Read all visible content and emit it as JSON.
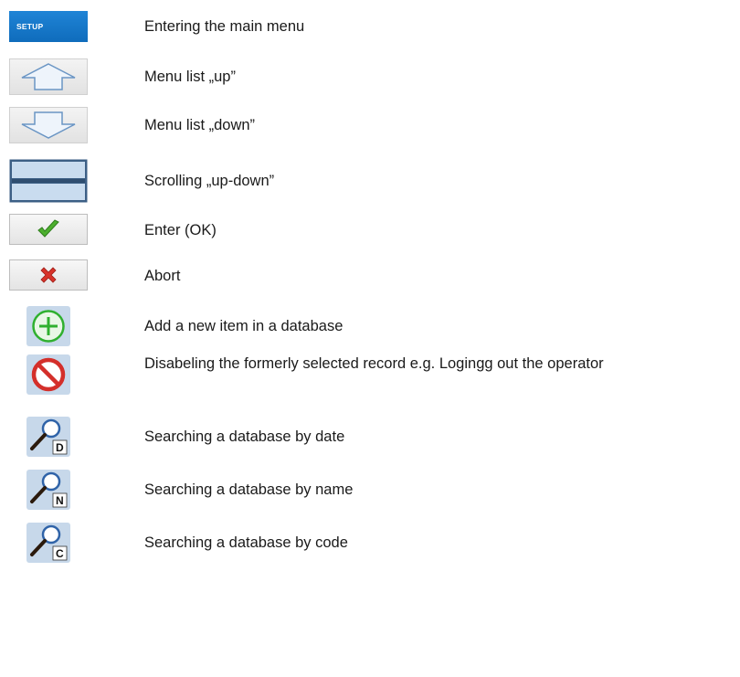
{
  "items": [
    {
      "icon": "setup-button",
      "button_text": "SETUP",
      "label": "Entering the main menu"
    },
    {
      "icon": "arrow-up-icon",
      "label": "Menu list „up”"
    },
    {
      "icon": "arrow-down-icon",
      "label": "Menu list „down”"
    },
    {
      "icon": "scroll-up-down-icon",
      "label": "Scrolling „up-down”"
    },
    {
      "icon": "checkmark-icon",
      "label": "Enter (OK)"
    },
    {
      "icon": "x-icon",
      "label": "Abort"
    },
    {
      "icon": "plus-circle-icon",
      "label": "Add a new item in a database"
    },
    {
      "icon": "no-entry-icon",
      "label": "Disabeling the formerly selected record e.g. Logingg out the operator"
    },
    {
      "icon": "search-date-icon",
      "badge": "D",
      "label": "Searching a database by date"
    },
    {
      "icon": "search-name-icon",
      "badge": "N",
      "label": "Searching a database by name"
    },
    {
      "icon": "search-code-icon",
      "badge": "C",
      "label": "Searching a database by code"
    }
  ],
  "colors": {
    "setup_blue": "#1577c9",
    "check_green": "#4caf2e",
    "abort_red": "#d8332a",
    "plus_green": "#2fb02f",
    "panel_blue": "#c7d8ea"
  }
}
